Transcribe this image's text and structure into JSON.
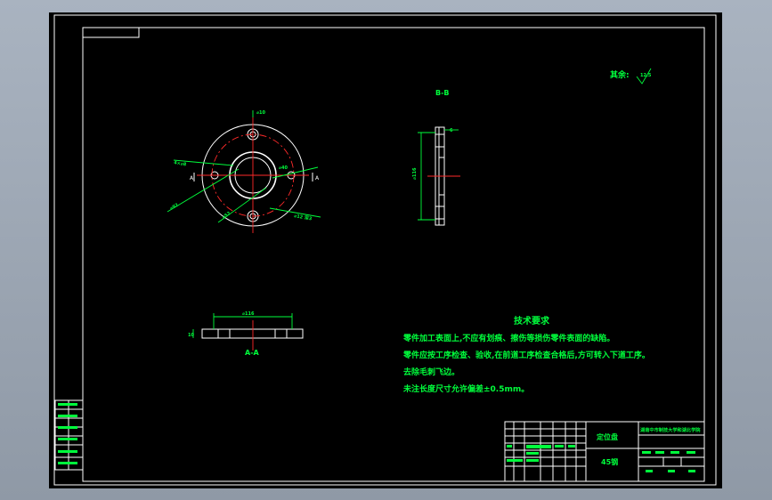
{
  "drawing": {
    "roughness_label": "其余:",
    "roughness_value": "12.5",
    "section_bb": "B-B",
    "section_aa": "A-A",
    "tech_req": {
      "title": "技术要求",
      "lines": [
        "零件加工表面上,不应有划痕、擦伤等损伤零件表面的缺陷。",
        "零件应按工序检查、验收,在前道工序检查合格后,方可转入下道工序。",
        "去除毛刺飞边。",
        "未注长度尺寸允许偏差±0.5mm。"
      ]
    },
    "title_block": {
      "part_name": "定位盘",
      "material": "45钢",
      "school": "湖南中市制技大学和湖北学院"
    }
  },
  "colors": {
    "background": "#000000",
    "geometry": "#ffffff",
    "centerline": "#ff2a2a",
    "annotation": "#00ff3c",
    "frame_bg": "#9aa4b1"
  }
}
